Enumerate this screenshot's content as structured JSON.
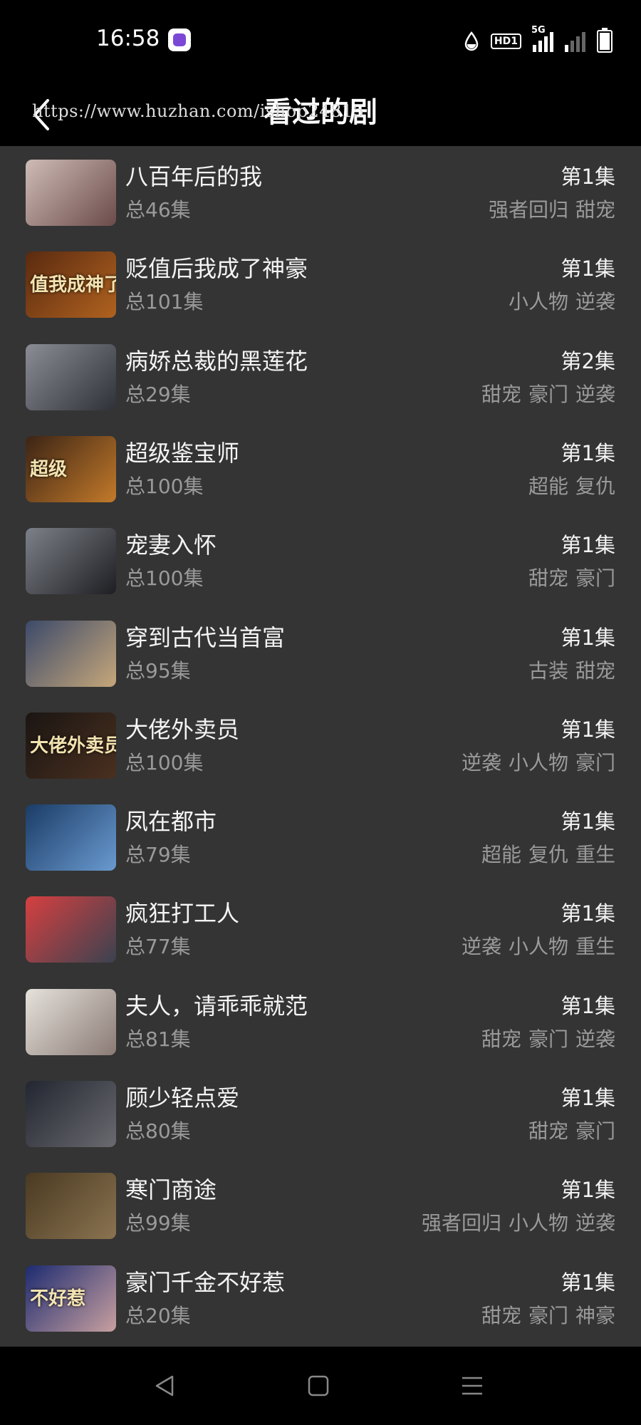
{
  "status_bar": {
    "time": "16:58",
    "hd_label": "HD1",
    "network_label": "5G"
  },
  "header": {
    "title": "看过的剧",
    "watermark": "https://www.huzhan.com/ishop24815"
  },
  "shows": [
    {
      "title": "八百年后的我",
      "total": "总46集",
      "episode": "第1集",
      "tags": [
        "强者回归",
        "甜宠"
      ]
    },
    {
      "title": "贬值后我成了神豪",
      "total": "总101集",
      "episode": "第1集",
      "tags": [
        "小人物",
        "逆袭"
      ],
      "thumb_text": "值我成神了"
    },
    {
      "title": "病娇总裁的黑莲花",
      "total": "总29集",
      "episode": "第2集",
      "tags": [
        "甜宠",
        "豪门",
        "逆袭"
      ]
    },
    {
      "title": "超级鉴宝师",
      "total": "总100集",
      "episode": "第1集",
      "tags": [
        "超能",
        "复仇"
      ],
      "thumb_text": "超级"
    },
    {
      "title": "宠妻入怀",
      "total": "总100集",
      "episode": "第1集",
      "tags": [
        "甜宠",
        "豪门"
      ]
    },
    {
      "title": "穿到古代当首富",
      "total": "总95集",
      "episode": "第1集",
      "tags": [
        "古装",
        "甜宠"
      ]
    },
    {
      "title": "大佬外卖员",
      "total": "总100集",
      "episode": "第1集",
      "tags": [
        "逆袭",
        "小人物",
        "豪门"
      ],
      "thumb_text": "大佬外卖员"
    },
    {
      "title": "凤在都市",
      "total": "总79集",
      "episode": "第1集",
      "tags": [
        "超能",
        "复仇",
        "重生"
      ]
    },
    {
      "title": "疯狂打工人",
      "total": "总77集",
      "episode": "第1集",
      "tags": [
        "逆袭",
        "小人物",
        "重生"
      ]
    },
    {
      "title": "夫人，请乖乖就范",
      "total": "总81集",
      "episode": "第1集",
      "tags": [
        "甜宠",
        "豪门",
        "逆袭"
      ]
    },
    {
      "title": "顾少轻点爱",
      "total": "总80集",
      "episode": "第1集",
      "tags": [
        "甜宠",
        "豪门"
      ]
    },
    {
      "title": "寒门商途",
      "total": "总99集",
      "episode": "第1集",
      "tags": [
        "强者回归",
        "小人物",
        "逆袭"
      ]
    },
    {
      "title": "豪门千金不好惹",
      "total": "总20集",
      "episode": "第1集",
      "tags": [
        "甜宠",
        "豪门",
        "神豪"
      ],
      "thumb_text": "不好惹"
    }
  ],
  "thumb_colors": [
    [
      "#cfbcb6",
      "#6b4b4a"
    ],
    [
      "#5a2a10",
      "#b0621f"
    ],
    [
      "#8a8d95",
      "#2f3138"
    ],
    [
      "#3b2415",
      "#c37a2a"
    ],
    [
      "#7c8088",
      "#1e1e22"
    ],
    [
      "#3c4a6a",
      "#c6a77a"
    ],
    [
      "#1a1512",
      "#4a3020"
    ],
    [
      "#1b3c66",
      "#6a9ad0"
    ],
    [
      "#d64040",
      "#3a4250"
    ],
    [
      "#e6e2dc",
      "#8a7a74"
    ],
    [
      "#222630",
      "#6a6a70"
    ],
    [
      "#4a3a22",
      "#8a7350"
    ],
    [
      "#1d2b70",
      "#c8a0a0"
    ]
  ]
}
